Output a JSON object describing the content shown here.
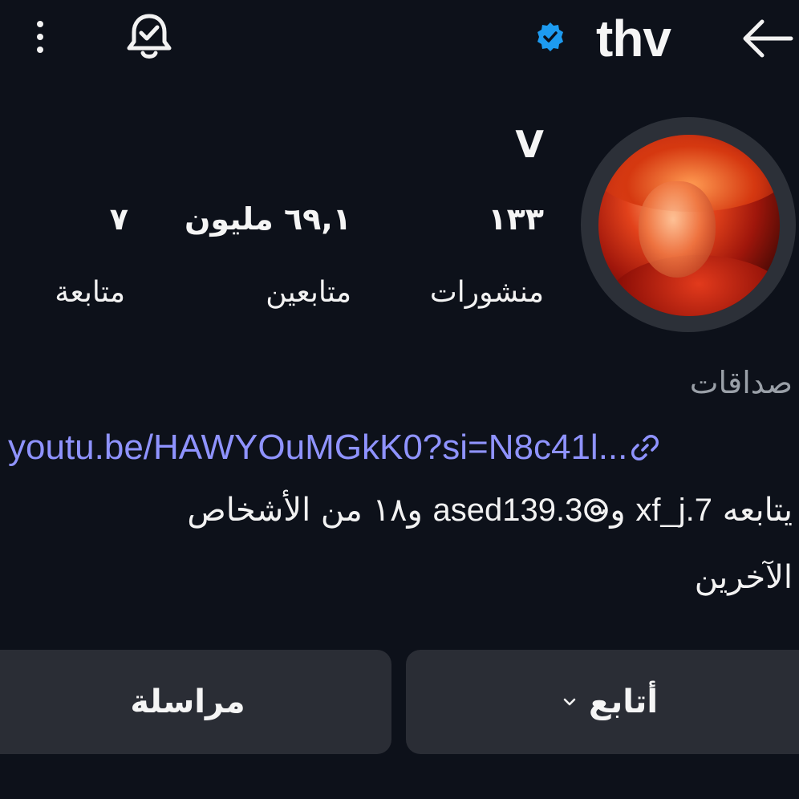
{
  "header": {
    "username": "thv",
    "icons": {
      "menu": "more-vertical-icon",
      "notifications": "bell-check-icon",
      "verified": "verified-badge-icon",
      "back": "arrow-back-icon"
    }
  },
  "profile": {
    "display_name": "V",
    "stats": [
      {
        "value": "١٣٣",
        "label": "منشورات"
      },
      {
        "value": "٦٩,١ مليون",
        "label": "متابعين"
      },
      {
        "value": "٧",
        "label": "متابعة"
      }
    ],
    "category": "صداقات",
    "link": {
      "text": "youtu.be/HAWYOuMGkK0?si=N8c41l...",
      "icon": "link-icon"
    },
    "followed_by": {
      "prefix": "يتابعه",
      "user1": "xf_j.7",
      "connector": "و",
      "threads_icon": "threads-icon",
      "user2": "ased139.3",
      "suffix": "و١٨ من الأشخاص",
      "line2": "الآخرين"
    }
  },
  "actions": {
    "follow_label": "أتابع",
    "message_label": "مراسلة"
  },
  "colors": {
    "background": "#0d111a",
    "button": "#2a2d35",
    "link": "#8f93ff",
    "muted": "#9aa0a8",
    "verified": "#1d9bf0"
  }
}
